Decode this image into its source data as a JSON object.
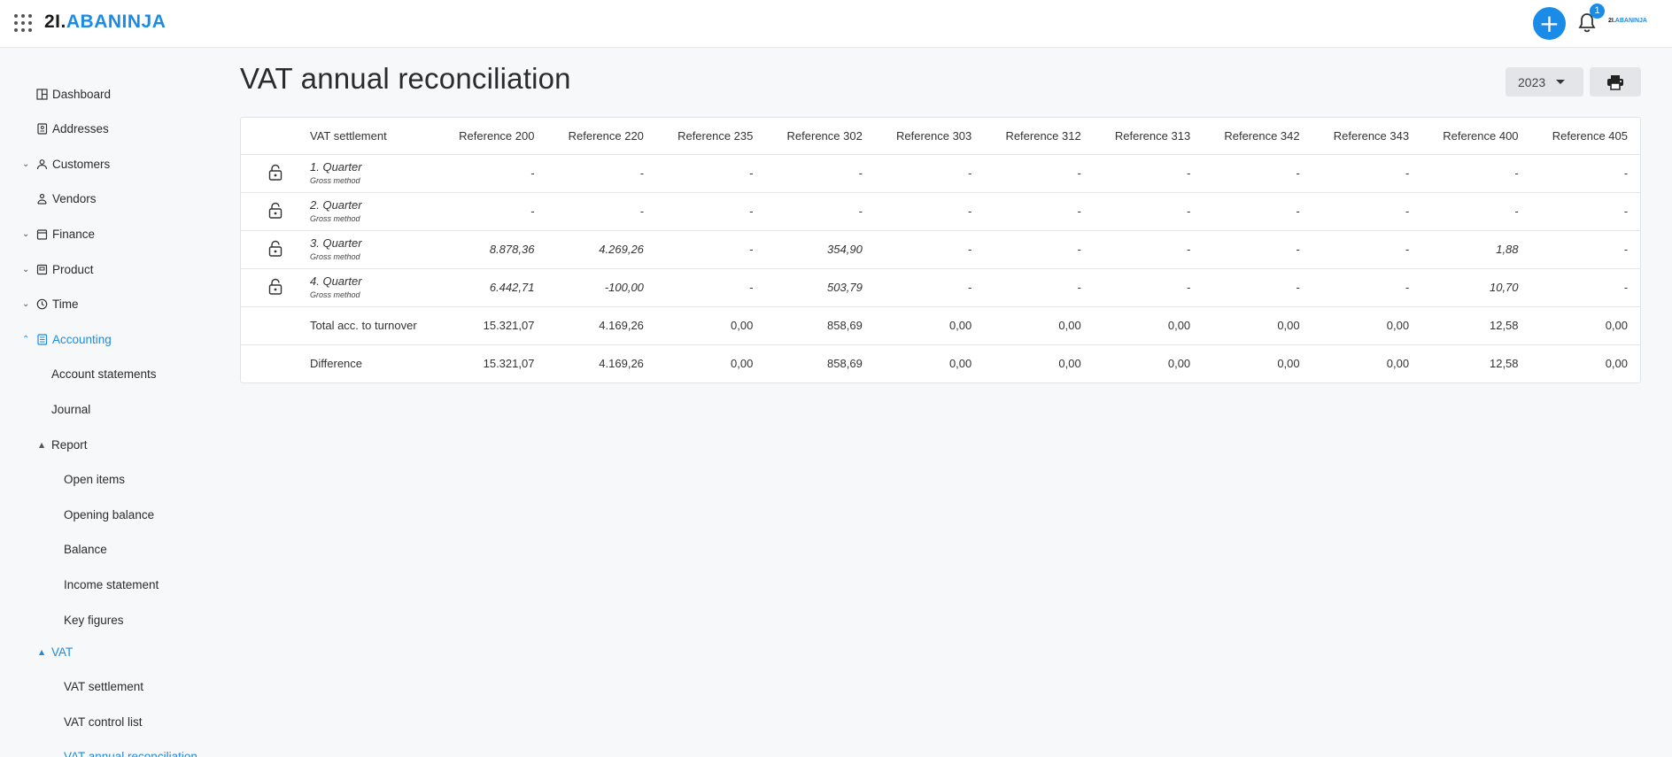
{
  "header": {
    "logo_num": "2I.",
    "logo_name": "ABANINJA",
    "notifications_count": "1",
    "small_logo_num": "2I.",
    "small_logo_name": "ABANINJA"
  },
  "sidebar": {
    "items": [
      {
        "label": "Dashboard",
        "icon": "dashboard-icon"
      },
      {
        "label": "Addresses",
        "icon": "address-book-icon"
      },
      {
        "label": "Customers",
        "icon": "customers-icon"
      },
      {
        "label": "Vendors",
        "icon": "vendors-icon"
      },
      {
        "label": "Finance",
        "icon": "finance-icon"
      },
      {
        "label": "Product",
        "icon": "product-icon"
      },
      {
        "label": "Time",
        "icon": "clock-icon"
      },
      {
        "label": "Accounting",
        "icon": "accounting-icon"
      },
      {
        "label": "Account statements"
      },
      {
        "label": "Journal"
      },
      {
        "label": "Report"
      },
      {
        "label": "Open items"
      },
      {
        "label": "Opening balance"
      },
      {
        "label": "Balance"
      },
      {
        "label": "Income statement"
      },
      {
        "label": "Key figures"
      },
      {
        "label": "VAT"
      },
      {
        "label": "VAT settlement"
      },
      {
        "label": "VAT control list"
      },
      {
        "label": "VAT annual reconciliation"
      }
    ]
  },
  "main": {
    "title": "VAT annual reconciliation",
    "year": "2023"
  },
  "table": {
    "columns": [
      "VAT settlement",
      "Reference 200",
      "Reference 220",
      "Reference 235",
      "Reference 302",
      "Reference 303",
      "Reference 312",
      "Reference 313",
      "Reference 342",
      "Reference 343",
      "Reference 400",
      "Reference 405"
    ],
    "quarters": [
      {
        "name": "1. Quarter",
        "method": "Gross method",
        "values": [
          "-",
          "-",
          "-",
          "-",
          "-",
          "-",
          "-",
          "-",
          "-",
          "-",
          "-"
        ]
      },
      {
        "name": "2. Quarter",
        "method": "Gross method",
        "values": [
          "-",
          "-",
          "-",
          "-",
          "-",
          "-",
          "-",
          "-",
          "-",
          "-",
          "-"
        ]
      },
      {
        "name": "3. Quarter",
        "method": "Gross method",
        "values": [
          "8.878,36",
          "4.269,26",
          "-",
          "354,90",
          "-",
          "-",
          "-",
          "-",
          "-",
          "1,88",
          "-"
        ]
      },
      {
        "name": "4. Quarter",
        "method": "Gross method",
        "values": [
          "6.442,71",
          "-100,00",
          "-",
          "503,79",
          "-",
          "-",
          "-",
          "-",
          "-",
          "10,70",
          "-"
        ]
      }
    ],
    "totals": [
      {
        "label": "Total acc. to turnover",
        "values": [
          "15.321,07",
          "4.169,26",
          "0,00",
          "858,69",
          "0,00",
          "0,00",
          "0,00",
          "0,00",
          "0,00",
          "12,58",
          "0,00"
        ]
      },
      {
        "label": "Difference",
        "values": [
          "15.321,07",
          "4.169,26",
          "0,00",
          "858,69",
          "0,00",
          "0,00",
          "0,00",
          "0,00",
          "0,00",
          "12,58",
          "0,00"
        ]
      }
    ]
  },
  "colors": {
    "accent": "#1b8be8",
    "background": "#f7f8f9"
  }
}
